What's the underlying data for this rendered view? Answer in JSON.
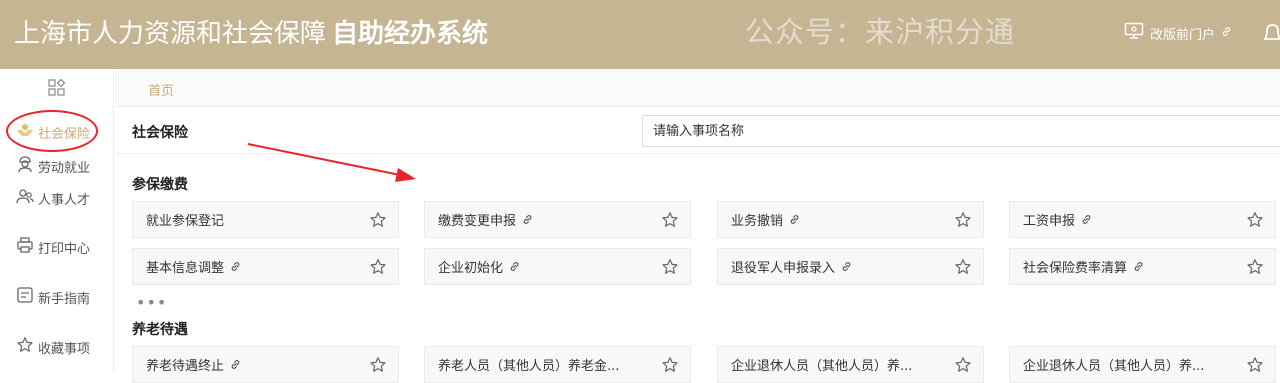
{
  "header": {
    "title_main": "上海市人力资源和社会保障",
    "title_bold": "自助经办系统",
    "watermark": "公众号：来沪积分通",
    "portal_link": "改版前门户"
  },
  "sidebar": {
    "items": [
      {
        "label": "社会保险",
        "icon": "hands-icon",
        "active": true
      },
      {
        "label": "劳动就业",
        "icon": "worker-icon"
      },
      {
        "label": "人事人才",
        "icon": "people-icon"
      },
      {
        "label": "打印中心",
        "icon": "printer-icon"
      },
      {
        "label": "新手指南",
        "icon": "guide-icon"
      },
      {
        "label": "收藏事项",
        "icon": "star-icon"
      }
    ]
  },
  "breadcrumb": "首页",
  "main": {
    "section_title": "社会保险",
    "search_placeholder": "请输入事项名称",
    "groups": [
      {
        "title": "参保缴费",
        "items": [
          {
            "label": "就业参保登记",
            "link": false
          },
          {
            "label": "缴费变更申报",
            "link": true
          },
          {
            "label": "业务撤销",
            "link": true
          },
          {
            "label": "工资申报",
            "link": true
          },
          {
            "label": "基本信息调整",
            "link": true
          },
          {
            "label": "企业初始化",
            "link": true
          },
          {
            "label": "退役军人申报录入",
            "link": true
          },
          {
            "label": "社会保险费率清算",
            "link": true
          }
        ],
        "more": "•••"
      },
      {
        "title": "养老待遇",
        "items": [
          {
            "label": "养老待遇终止",
            "link": true
          },
          {
            "label": "养老人员（其他人员）养老金...",
            "link": false
          },
          {
            "label": "企业退休人员（其他人员）养...",
            "link": false
          },
          {
            "label": "企业退休人员（其他人员）养...",
            "link": false
          }
        ]
      }
    ]
  },
  "colors": {
    "header_bg": "#c5b593",
    "accent": "#c8ac77",
    "annotation": "#e8252a"
  }
}
